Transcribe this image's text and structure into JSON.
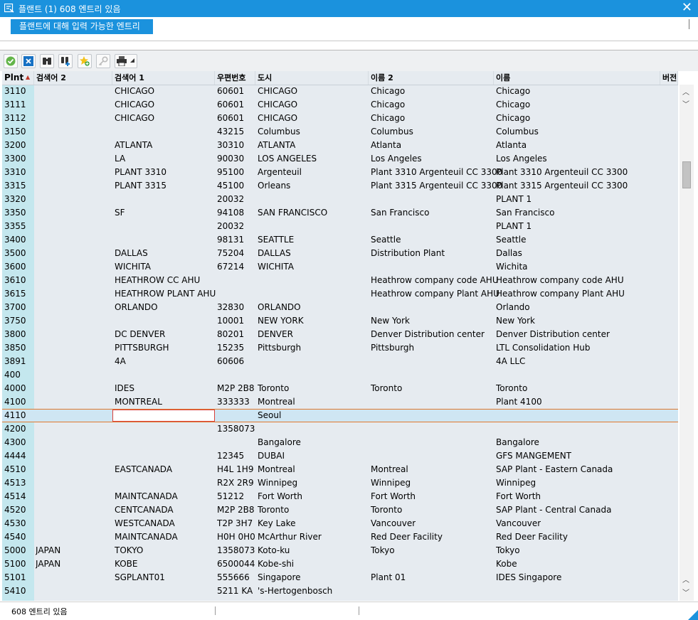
{
  "window": {
    "title": "플랜트 (1)  608 엔트리 있음",
    "close_glyph": "✕"
  },
  "info_button": "플랜트에 대해 입력 가능한 엔트리",
  "toolbar": {
    "buttons": [
      "check-icon",
      "cancel-icon",
      "find-icon",
      "find-next-icon",
      "new-entry-icon",
      "key-icon",
      "print-icon"
    ]
  },
  "columns": [
    {
      "key": "plnt",
      "label": "Plnt"
    },
    {
      "key": "search2",
      "label": "검색어 2"
    },
    {
      "key": "search1",
      "label": "검색어 1"
    },
    {
      "key": "postal",
      "label": "우편번호"
    },
    {
      "key": "city",
      "label": "도시"
    },
    {
      "key": "name2",
      "label": "이름 2"
    },
    {
      "key": "name",
      "label": "이름"
    },
    {
      "key": "version",
      "label": "버전"
    }
  ],
  "rows": [
    [
      "3110",
      "",
      "CHICAGO",
      "60601",
      "CHICAGO",
      "Chicago",
      "Chicago"
    ],
    [
      "3111",
      "",
      "CHICAGO",
      "60601",
      "CHICAGO",
      "Chicago",
      "Chicago"
    ],
    [
      "3112",
      "",
      "CHICAGO",
      "60601",
      "CHICAGO",
      "Chicago",
      "Chicago"
    ],
    [
      "3150",
      "",
      "",
      "43215",
      "Columbus",
      "Columbus",
      "Columbus"
    ],
    [
      "3200",
      "",
      "ATLANTA",
      "30310",
      "ATLANTA",
      "Atlanta",
      "Atlanta"
    ],
    [
      "3300",
      "",
      "LA",
      "90030",
      "LOS ANGELES",
      "Los Angeles",
      "Los Angeles"
    ],
    [
      "3310",
      "",
      "PLANT 3310",
      "95100",
      "Argenteuil",
      "Plant 3310 Argenteuil CC 3300",
      "Plant 3310 Argenteuil CC 3300"
    ],
    [
      "3315",
      "",
      "PLANT 3315",
      "45100",
      "Orleans",
      "Plant 3315 Argenteuil CC 3300",
      "Plant 3315 Argenteuil CC 3300"
    ],
    [
      "3320",
      "",
      "",
      "20032",
      "",
      "",
      "PLANT 1"
    ],
    [
      "3350",
      "",
      "SF",
      "94108",
      "SAN FRANCISCO",
      "San Francisco",
      "San Francisco"
    ],
    [
      "3355",
      "",
      "",
      "20032",
      "",
      "",
      "PLANT 1"
    ],
    [
      "3400",
      "",
      "",
      "98131",
      "SEATTLE",
      "Seattle",
      "Seattle"
    ],
    [
      "3500",
      "",
      "DALLAS",
      "75204",
      "DALLAS",
      "Distribution Plant",
      "Dallas"
    ],
    [
      "3600",
      "",
      "WICHITA",
      "67214",
      "WICHITA",
      "",
      "Wichita"
    ],
    [
      "3610",
      "",
      "HEATHROW CC AHU",
      "",
      "",
      "Heathrow company code AHU",
      "Heathrow company code AHU"
    ],
    [
      "3615",
      "",
      "HEATHROW PLANT AHU",
      "",
      "",
      "Heathrow company Plant AHU",
      "Heathrow company Plant AHU"
    ],
    [
      "3700",
      "",
      "ORLANDO",
      "32830",
      "ORLANDO",
      "",
      "Orlando"
    ],
    [
      "3750",
      "",
      "",
      "10001",
      "NEW YORK",
      "New York",
      "New York"
    ],
    [
      "3800",
      "",
      "DC DENVER",
      "80201",
      "DENVER",
      "Denver Distribution center",
      "Denver Distribution center"
    ],
    [
      "3850",
      "",
      "PITTSBURGH",
      "15235",
      "Pittsburgh",
      "Pittsburgh",
      "LTL Consolidation Hub"
    ],
    [
      "3891",
      "",
      "4A",
      "60606",
      "",
      "",
      "4A LLC"
    ],
    [
      "400",
      "",
      "",
      "",
      "",
      "",
      ""
    ],
    [
      "4000",
      "",
      "IDES",
      "M2P 2B8",
      "Toronto",
      "Toronto",
      "Toronto"
    ],
    [
      "4100",
      "",
      "MONTREAL",
      "333333",
      "Montreal",
      "",
      "Plant 4100"
    ],
    [
      "4110",
      "",
      "",
      "",
      "Seoul",
      "",
      ""
    ],
    [
      "4200",
      "",
      "",
      "1358073",
      "",
      "",
      ""
    ],
    [
      "4300",
      "",
      "",
      "",
      "Bangalore",
      "",
      "Bangalore"
    ],
    [
      "4444",
      "",
      "",
      "12345",
      "DUBAI",
      "",
      "GFS MANGEMENT"
    ],
    [
      "4510",
      "",
      "EASTCANADA",
      "H4L 1H9",
      "Montreal",
      "Montreal",
      "SAP Plant - Eastern Canada"
    ],
    [
      "4513",
      "",
      "",
      "R2X 2R9",
      "Winnipeg",
      "Winnipeg",
      "Winnipeg"
    ],
    [
      "4514",
      "",
      "MAINTCANADA",
      "51212",
      "Fort  Worth",
      "Fort Worth",
      "Fort Worth"
    ],
    [
      "4520",
      "",
      "CENTCANADA",
      "M2P 2B8",
      "Toronto",
      "Toronto",
      "SAP Plant - Central Canada"
    ],
    [
      "4530",
      "",
      "WESTCANADA",
      "T2P 3H7",
      "Key Lake",
      "Vancouver",
      "Vancouver"
    ],
    [
      "4540",
      "",
      "MAINTCANADA",
      "H0H 0H0",
      "McArthur River",
      "Red Deer Facility",
      "Red Deer Facility"
    ],
    [
      "5000",
      "JAPAN",
      "TOKYO",
      "1358073",
      "Koto-ku",
      "Tokyo",
      "Tokyo"
    ],
    [
      "5100",
      "JAPAN",
      "KOBE",
      "6500044",
      "Kobe-shi",
      "",
      "Kobe"
    ],
    [
      "5101",
      "",
      "SGPLANT01",
      "555666",
      "Singapore",
      "Plant 01",
      "IDES Singapore"
    ],
    [
      "5410",
      "",
      "",
      "5211 KA",
      "'s-Hertogenbosch",
      "",
      ""
    ]
  ],
  "selected_row": "4110",
  "status": {
    "text": "608 엔트리 있음"
  }
}
